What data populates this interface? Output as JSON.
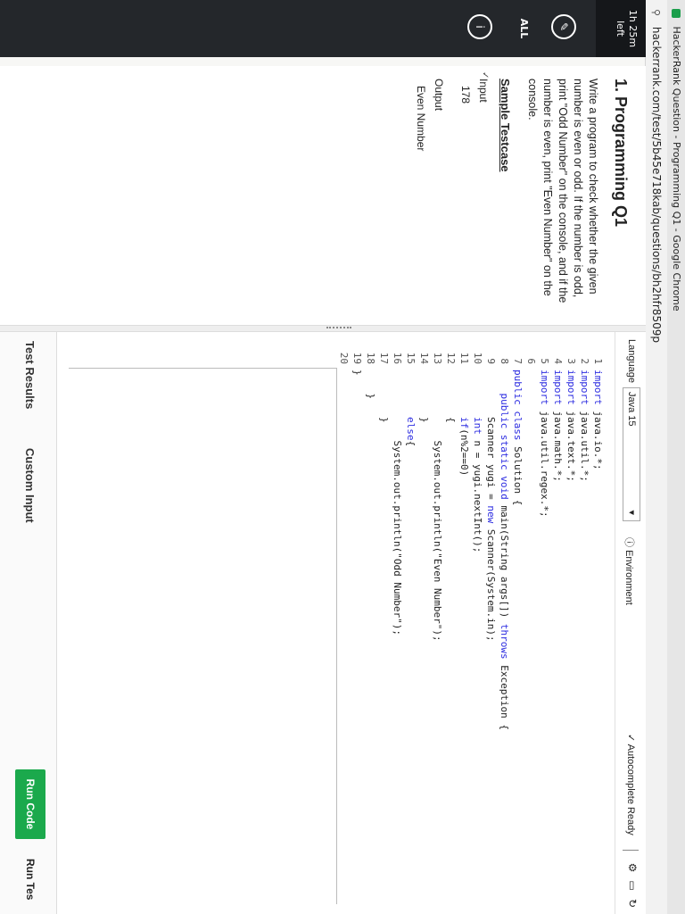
{
  "browser": {
    "window_title": "HackerRank Question - Programming Q1 - Google Chrome",
    "url": "hackerrank.com/test/5b45e718kab/questions/bh2hfr8509p"
  },
  "rail": {
    "time_value": "1h 25m",
    "time_unit": "left",
    "all_label": "ALL"
  },
  "problem": {
    "title": "1. Programming Q1",
    "description": "Write a program to check whether the given number is even or odd. If the number is odd, print \"Odd Number\" on the console, and if the number is even, print \"Even Number\" on the console.",
    "sample_heading": "Sample Testcase",
    "input_label": "Input",
    "input_value": "178",
    "output_label": "Output",
    "output_value": "Even Number"
  },
  "editor": {
    "language_label": "Language",
    "language_value": "Java 15",
    "environment_label": "Environment",
    "autocomplete_label": "Autocomplete Ready"
  },
  "code_lines": [
    {
      "n": "1",
      "text": "import java.io.*;"
    },
    {
      "n": "2",
      "text": "import java.util.*;"
    },
    {
      "n": "3",
      "text": "import java.text.*;"
    },
    {
      "n": "4",
      "text": "import java.math.*;"
    },
    {
      "n": "5",
      "text": "import java.util.regex.*;"
    },
    {
      "n": "6",
      "text": ""
    },
    {
      "n": "7",
      "text": "public class Solution {"
    },
    {
      "n": "8",
      "text": "    public static void main(String args[]) throws Exception {"
    },
    {
      "n": "9",
      "text": "        Scanner yugi = new Scanner(System.in);"
    },
    {
      "n": "10",
      "text": "        int n = yugi.nextInt();"
    },
    {
      "n": "11",
      "text": "        if(n%2==0)"
    },
    {
      "n": "12",
      "text": "        {"
    },
    {
      "n": "13",
      "text": "            System.out.println(\"Even Number\");"
    },
    {
      "n": "14",
      "text": "        }"
    },
    {
      "n": "15",
      "text": "        else{"
    },
    {
      "n": "16",
      "text": "            System.out.println(\"Odd Number\");"
    },
    {
      "n": "17",
      "text": "        }"
    },
    {
      "n": "18",
      "text": "    }"
    },
    {
      "n": "19",
      "text": "}"
    },
    {
      "n": "20",
      "text": ""
    }
  ],
  "bottom": {
    "test_results_tab": "Test Results",
    "custom_input_tab": "Custom Input",
    "run_code_label": "Run Code",
    "run_tests_label": "Run Tes"
  },
  "colors": {
    "rail_bg": "#24272b",
    "run_button": "#1ba94c",
    "keyword": "#2b2be0"
  }
}
